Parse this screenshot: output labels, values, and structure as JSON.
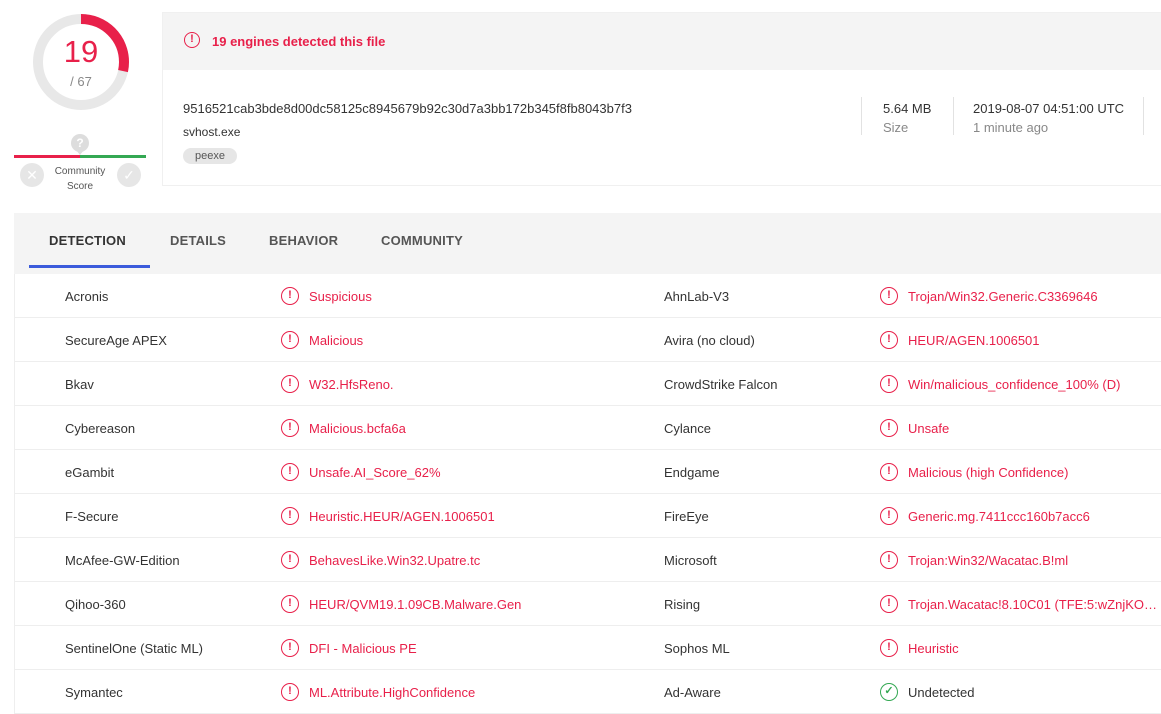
{
  "score": {
    "detected": "19",
    "total": "/ 67",
    "ratio": 0.2836,
    "color": "#e8204a"
  },
  "community": {
    "question": "?",
    "label_line1": "Community",
    "label_line2": "Score",
    "downvote_icon": "x-icon",
    "upvote_icon": "check-icon"
  },
  "file": {
    "alert_text": "19 engines detected this file",
    "hash": "9516521cab3bde8d00dc58125c8945679b92c30d7a3bb172b345f8fb8043b7f3",
    "name": "svhost.exe",
    "tag": "peexe",
    "size_value": "5.64 MB",
    "size_label": "Size",
    "date_value": "2019-08-07 04:51:00 UTC",
    "date_label": "1 minute ago"
  },
  "tabs": [
    {
      "label": "DETECTION",
      "active": true
    },
    {
      "label": "DETAILS",
      "active": false
    },
    {
      "label": "BEHAVIOR",
      "active": false
    },
    {
      "label": "COMMUNITY",
      "active": false
    }
  ],
  "colors": {
    "malicious": "#e8204a",
    "clean": "#34a853",
    "tab_accent": "#3b5bdb"
  },
  "detections": [
    {
      "left": {
        "engine": "Acronis",
        "result": "Suspicious",
        "status": "malicious"
      },
      "right": {
        "engine": "AhnLab-V3",
        "result": "Trojan/Win32.Generic.C3369646",
        "status": "malicious"
      }
    },
    {
      "left": {
        "engine": "SecureAge APEX",
        "result": "Malicious",
        "status": "malicious"
      },
      "right": {
        "engine": "Avira (no cloud)",
        "result": "HEUR/AGEN.1006501",
        "status": "malicious"
      }
    },
    {
      "left": {
        "engine": "Bkav",
        "result": "W32.HfsReno.",
        "status": "malicious"
      },
      "right": {
        "engine": "CrowdStrike Falcon",
        "result": "Win/malicious_confidence_100% (D)",
        "status": "malicious"
      }
    },
    {
      "left": {
        "engine": "Cybereason",
        "result": "Malicious.bcfa6a",
        "status": "malicious"
      },
      "right": {
        "engine": "Cylance",
        "result": "Unsafe",
        "status": "malicious"
      }
    },
    {
      "left": {
        "engine": "eGambit",
        "result": "Unsafe.AI_Score_62%",
        "status": "malicious"
      },
      "right": {
        "engine": "Endgame",
        "result": "Malicious (high Confidence)",
        "status": "malicious"
      }
    },
    {
      "left": {
        "engine": "F-Secure",
        "result": "Heuristic.HEUR/AGEN.1006501",
        "status": "malicious"
      },
      "right": {
        "engine": "FireEye",
        "result": "Generic.mg.7411ccc160b7acc6",
        "status": "malicious"
      }
    },
    {
      "left": {
        "engine": "McAfee-GW-Edition",
        "result": "BehavesLike.Win32.Upatre.tc",
        "status": "malicious"
      },
      "right": {
        "engine": "Microsoft",
        "result": "Trojan:Win32/Wacatac.B!ml",
        "status": "malicious"
      }
    },
    {
      "left": {
        "engine": "Qihoo-360",
        "result": "HEUR/QVM19.1.09CB.Malware.Gen",
        "status": "malicious"
      },
      "right": {
        "engine": "Rising",
        "result": "Trojan.Wacatac!8.10C01 (TFE:5:wZnjKO…",
        "status": "malicious"
      }
    },
    {
      "left": {
        "engine": "SentinelOne (Static ML)",
        "result": "DFI - Malicious PE",
        "status": "malicious"
      },
      "right": {
        "engine": "Sophos ML",
        "result": "Heuristic",
        "status": "malicious"
      }
    },
    {
      "left": {
        "engine": "Symantec",
        "result": "ML.Attribute.HighConfidence",
        "status": "malicious"
      },
      "right": {
        "engine": "Ad-Aware",
        "result": "Undetected",
        "status": "clean"
      }
    }
  ]
}
